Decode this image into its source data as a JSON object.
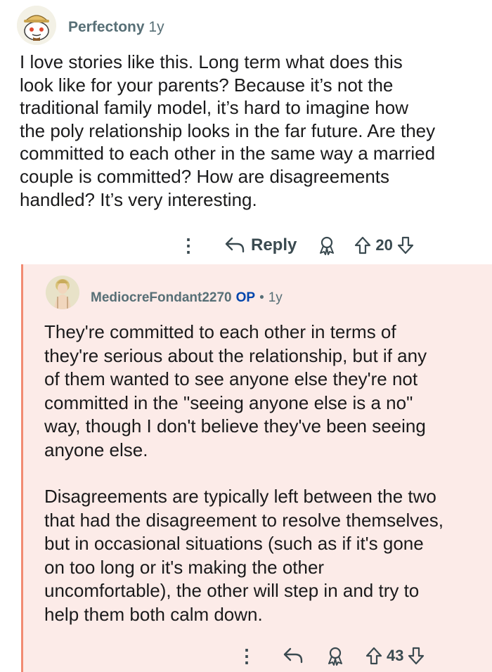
{
  "parent_comment": {
    "username": "Perfectony",
    "age": "1y",
    "text": "I love stories like this. Long term what does this\nlook like for your parents? Because it’s not the\ntraditional family model, it’s hard to imagine how\nthe poly relationship looks in the far future. Are they\ncommitted to each other in the same way a married\ncouple is committed? How are disagreements\nhandled? It’s very interesting.",
    "reply_label": "Reply",
    "score": "20",
    "icons": [
      "kebab-menu-icon",
      "reply-arrow-icon",
      "award-icon",
      "upvote-icon",
      "downvote-icon"
    ]
  },
  "reply_comment": {
    "username": "MediocreFondant2270",
    "op_badge": "OP",
    "separator": "•",
    "age": "1y",
    "paragraph_1": "They're committed to each other in terms of\nthey're serious about the relationship, but if any\nof them wanted to see anyone else they're not\ncommitted in the \"seeing anyone else is a no\"\nway, though I don't believe they've been seeing\nanyone else.",
    "paragraph_2": "Disagreements are typically left between the two\nthat had the disagreement to resolve themselves,\nbut in occasional situations (such as if it's gone\non too long or it's making the other\nuncomfortable), the other will step in and try to\nhelp them both calm down.",
    "score": "43",
    "icons": [
      "kebab-menu-icon",
      "reply-arrow-icon",
      "award-icon",
      "upvote-icon",
      "downvote-icon"
    ]
  },
  "colors": {
    "reply_background": "#fcebe8",
    "thread_line": "#f28b72",
    "username": "#576f76",
    "op_badge": "#0045ac",
    "text": "#1a1a1b"
  }
}
